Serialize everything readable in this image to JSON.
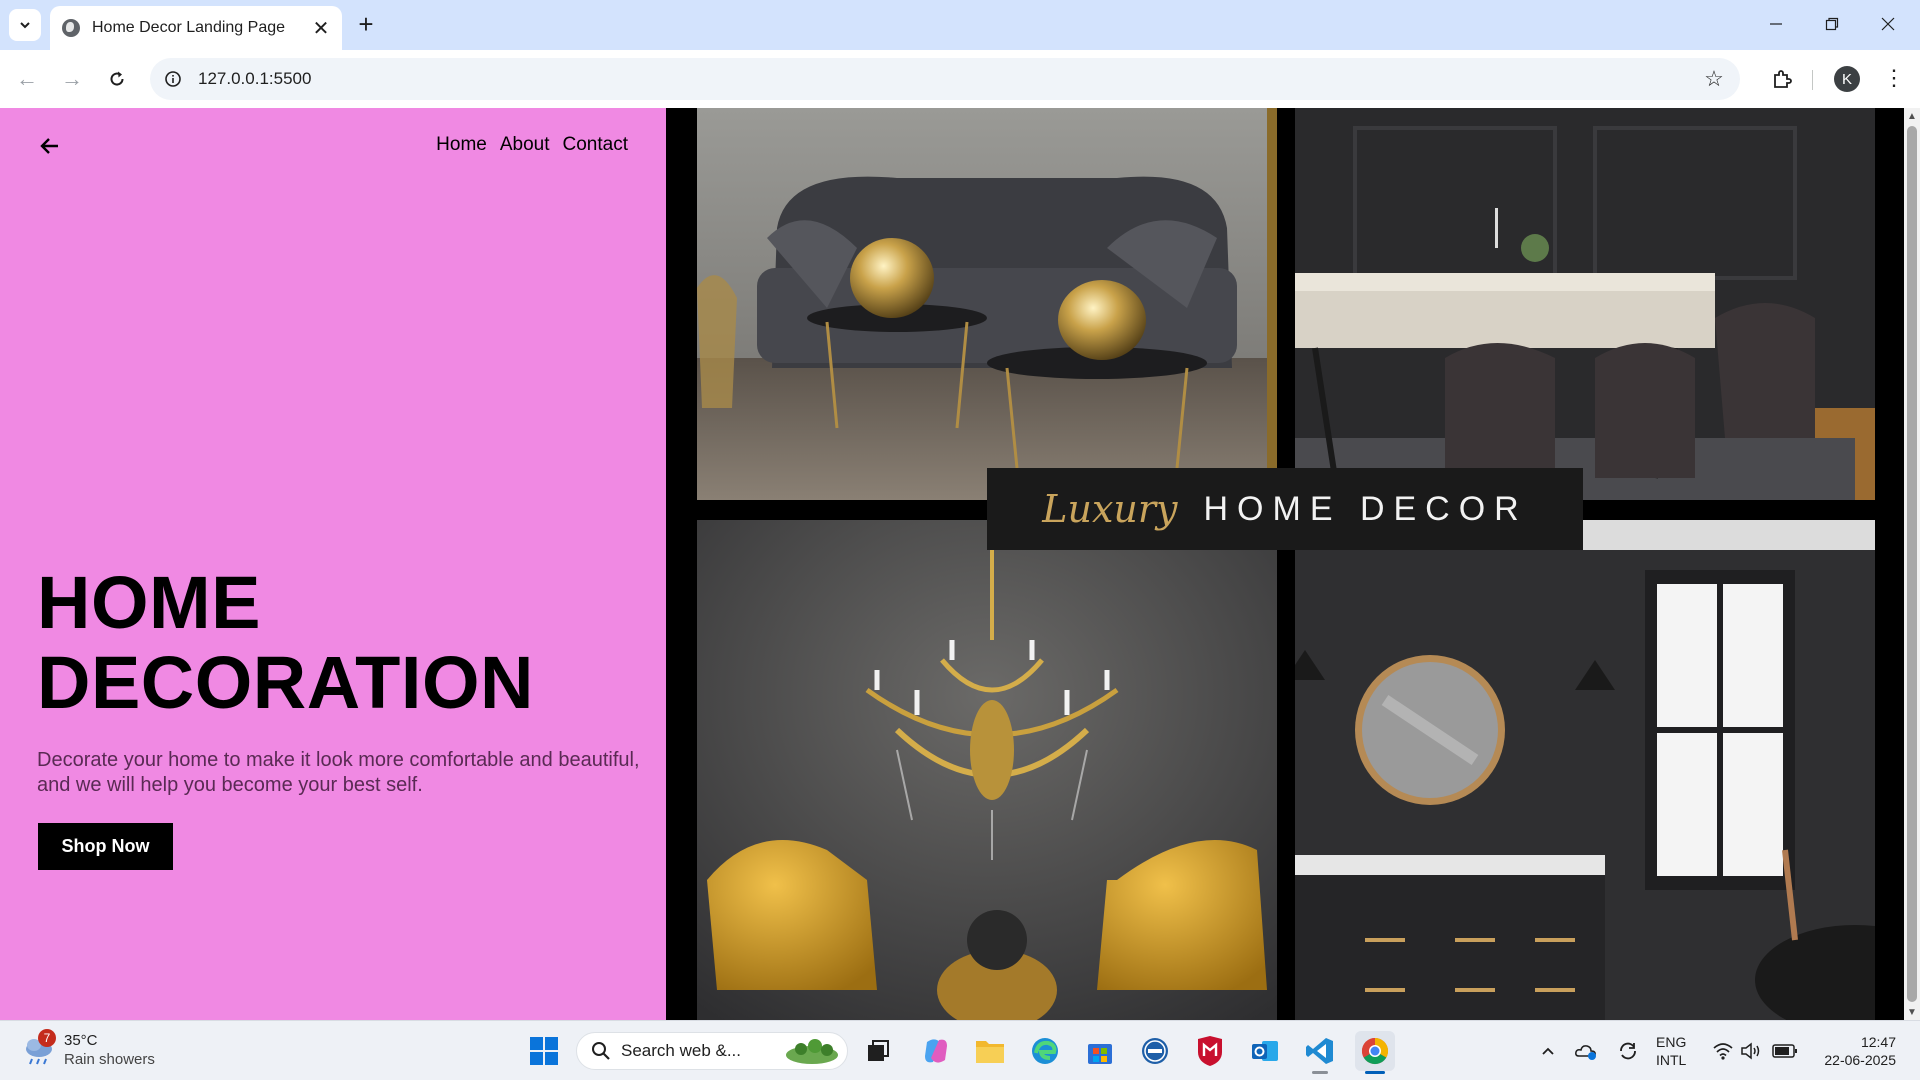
{
  "browser": {
    "tab_title": "Home Decor Landing Page",
    "url": "127.0.0.1:5500",
    "profile_initial": "K"
  },
  "page": {
    "nav": [
      "Home",
      "About",
      "Contact"
    ],
    "hero_title_line1": "HOME",
    "hero_title_line2": "DECORATION",
    "hero_description": "Decorate your home to make it look more comfortable and beautiful, and we will help you become your best self.",
    "cta_label": "Shop Now",
    "banner_script": "Luxury",
    "banner_text": "HOME DECOR",
    "colors": {
      "panel": "#f089e3",
      "button": "#000000",
      "banner_gold": "#c9a45c"
    }
  },
  "taskbar": {
    "weather_badge": "7",
    "temperature": "35°C",
    "weather_desc": "Rain showers",
    "search_placeholder": "Search web &...",
    "lang_line1": "ENG",
    "lang_line2": "INTL",
    "time": "12:47",
    "date": "22-06-2025"
  }
}
